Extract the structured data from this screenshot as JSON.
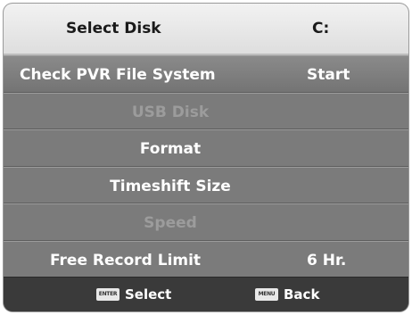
{
  "header": {
    "label": "Select Disk",
    "value": "C:"
  },
  "menu": {
    "items": [
      {
        "label": "Check PVR File System",
        "value": "Start",
        "enabled": true
      },
      {
        "label": "USB Disk",
        "value": "",
        "enabled": false
      },
      {
        "label": "Format",
        "value": "",
        "enabled": true
      },
      {
        "label": "Timeshift Size",
        "value": "",
        "enabled": true
      },
      {
        "label": "Speed",
        "value": "",
        "enabled": false
      },
      {
        "label": "Free Record Limit",
        "value": "6 Hr.",
        "enabled": true
      }
    ]
  },
  "footer": {
    "enter_icon_text": "ENTER",
    "select_label": "Select",
    "menu_icon_text": "MENU",
    "back_label": "Back"
  }
}
